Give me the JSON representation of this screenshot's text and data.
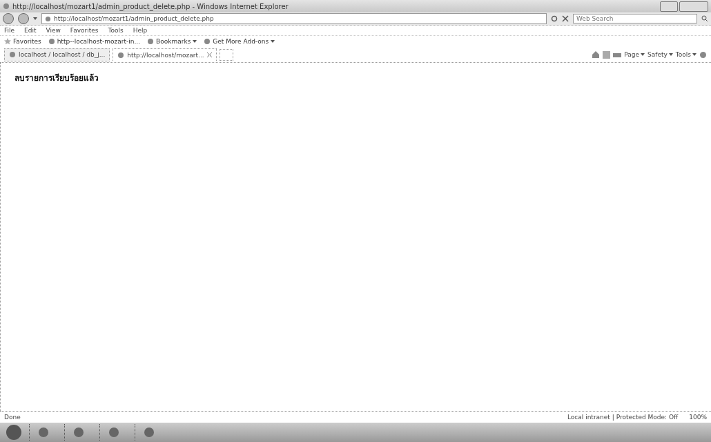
{
  "window": {
    "title": "http://localhost/mozart1/admin_product_delete.php - Windows Internet Explorer"
  },
  "address_bar": {
    "url": "http://localhost/mozart1/admin_product_delete.php"
  },
  "search": {
    "placeholder": "Web Search"
  },
  "menu": [
    "File",
    "Edit",
    "View",
    "Favorites",
    "Tools",
    "Help"
  ],
  "favorites_bar": {
    "label": "Favorites",
    "items": [
      {
        "label": "http--localhost-mozart-in...",
        "dropdown": false
      },
      {
        "label": "Bookmarks",
        "dropdown": true
      },
      {
        "label": "Get More Add-ons",
        "dropdown": true
      }
    ]
  },
  "tabs": [
    {
      "label": "localhost / localhost / db_j...",
      "selected": false
    },
    {
      "label": "http://localhost/mozart...",
      "selected": true
    }
  ],
  "command_bar": [
    "Page",
    "Safety",
    "Tools"
  ],
  "page": {
    "message": "ลบรายการเรียบร้อยแล้ว"
  },
  "status_bar": {
    "status": "Done",
    "zone": "Local intranet | Protected Mode: Off",
    "zoom": "100%"
  }
}
